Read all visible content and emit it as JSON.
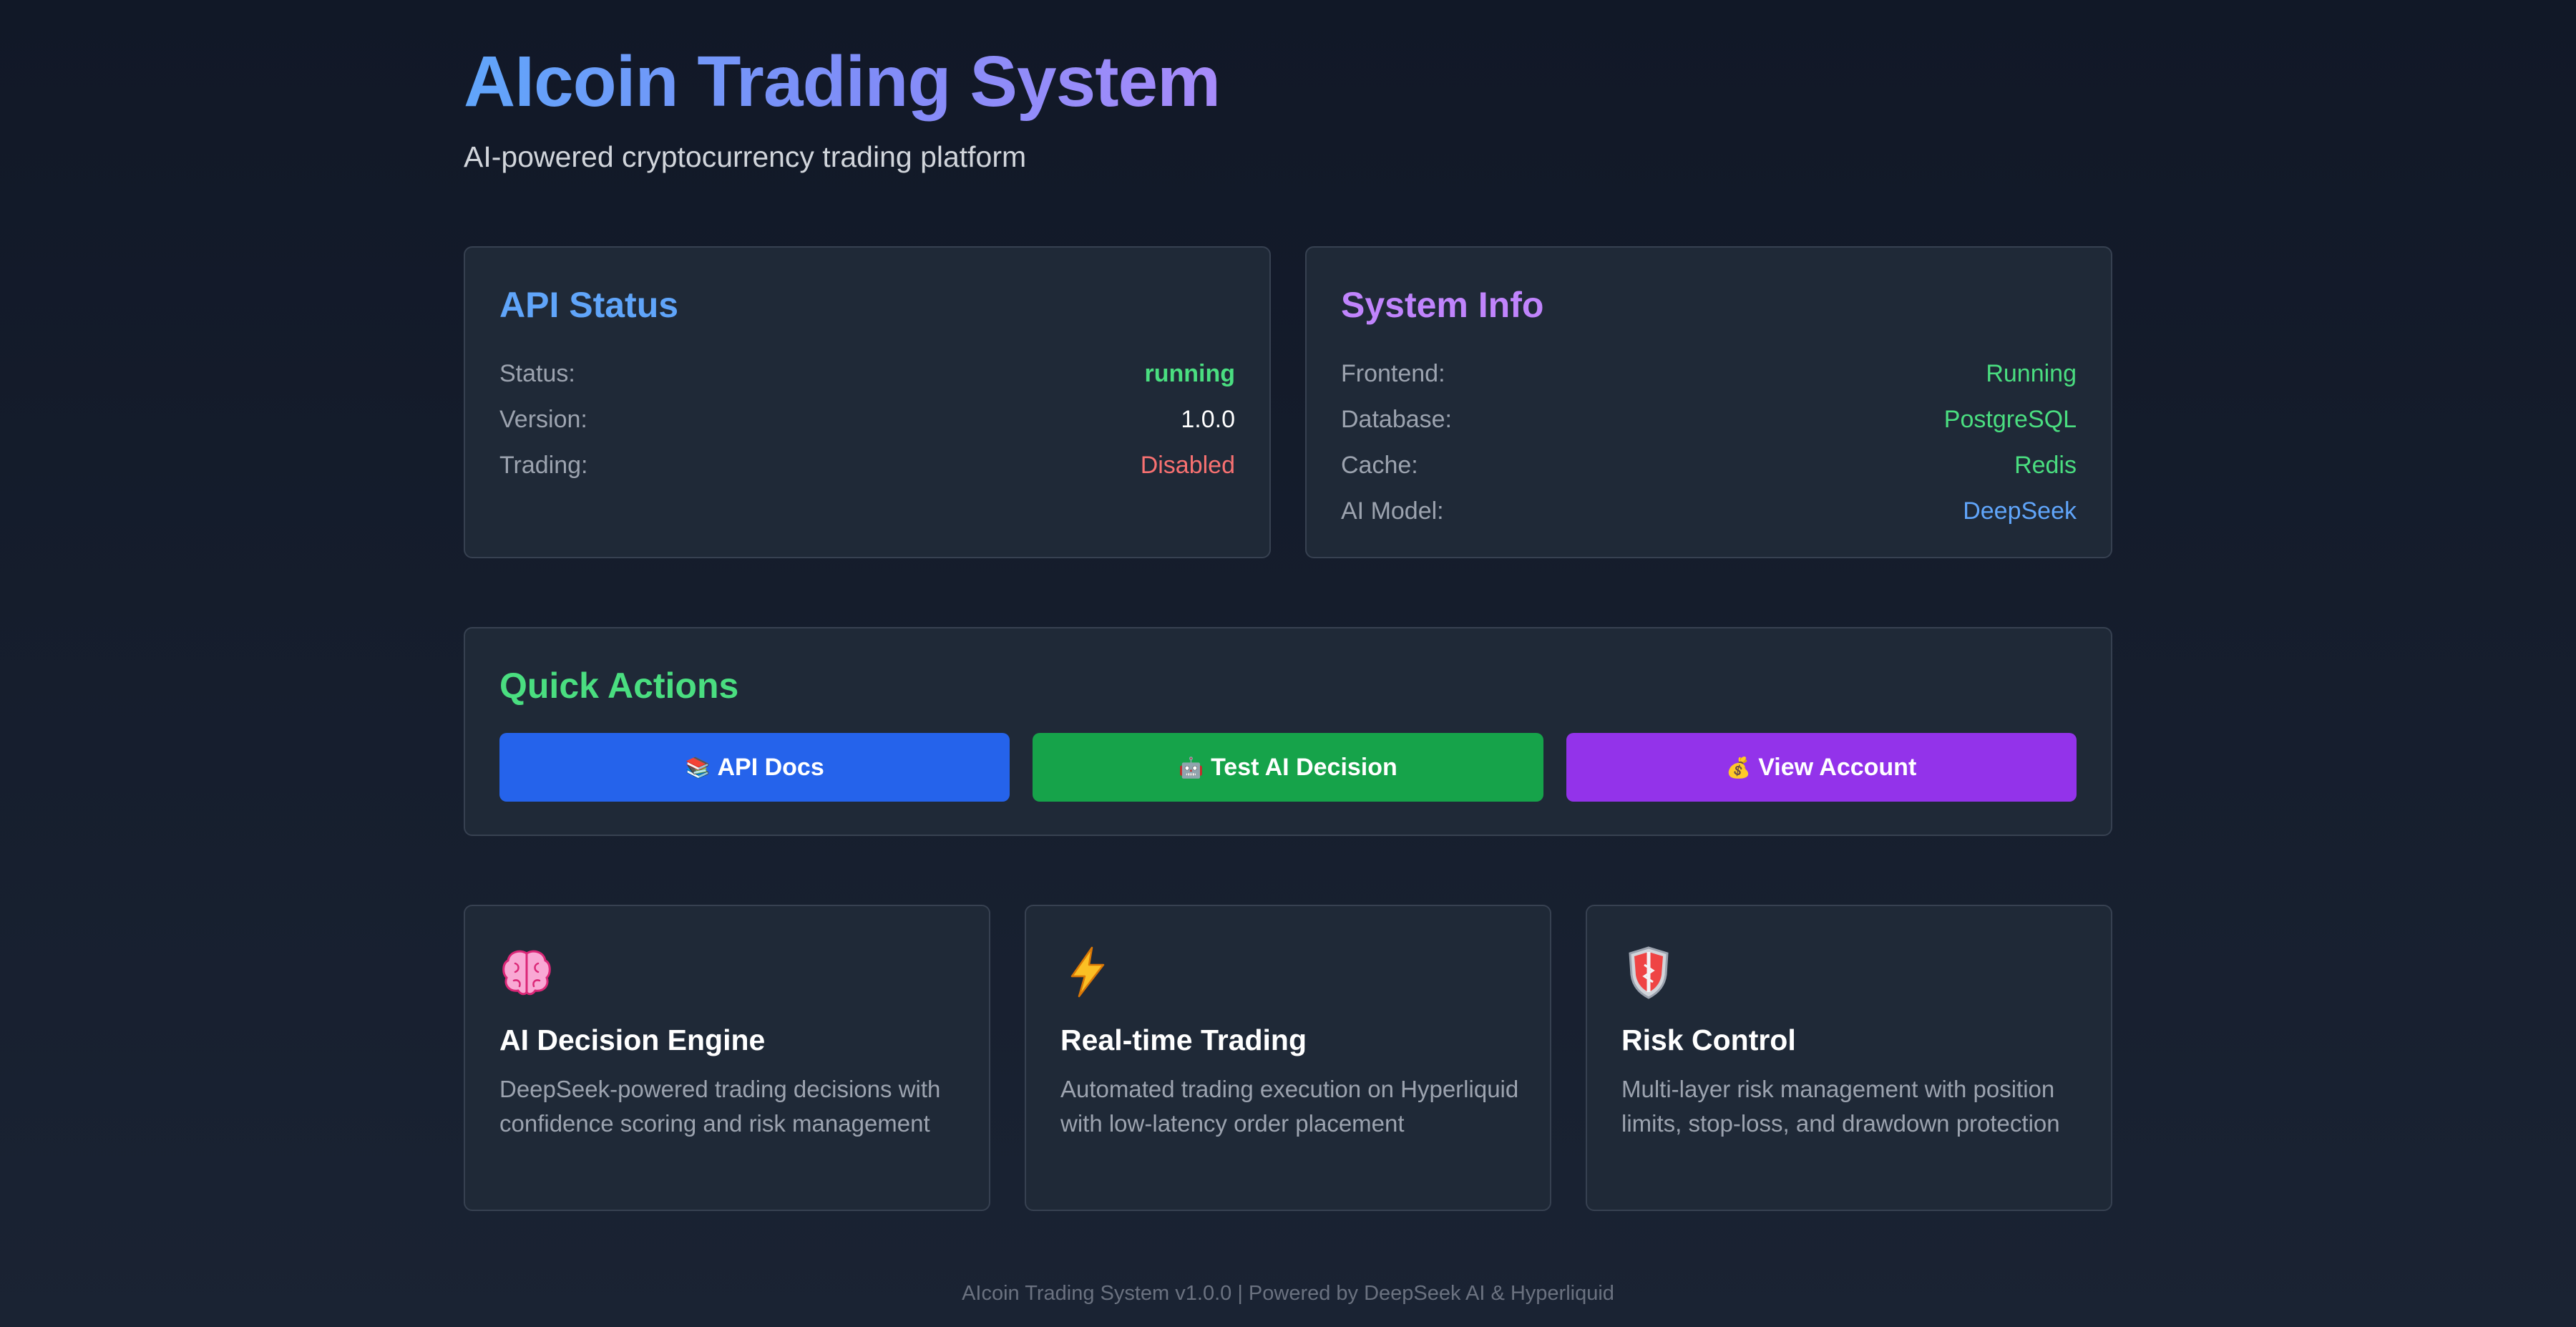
{
  "header": {
    "title": "AIcoin Trading System",
    "subtitle": "AI-powered cryptocurrency trading platform"
  },
  "api_status": {
    "title": "API Status",
    "rows": [
      {
        "label": "Status:",
        "value": "running"
      },
      {
        "label": "Version:",
        "value": "1.0.0"
      },
      {
        "label": "Trading:",
        "value": "Disabled"
      }
    ]
  },
  "system_info": {
    "title": "System Info",
    "rows": [
      {
        "label": "Frontend:",
        "value": "Running"
      },
      {
        "label": "Database:",
        "value": "PostgreSQL"
      },
      {
        "label": "Cache:",
        "value": "Redis"
      },
      {
        "label": "AI Model:",
        "value": "DeepSeek"
      }
    ]
  },
  "quick_actions": {
    "title": "Quick Actions",
    "buttons": [
      {
        "emoji": "📚",
        "label": "API Docs",
        "icon": "books-icon",
        "color": "#2563eb"
      },
      {
        "emoji": "🤖",
        "label": "Test AI Decision",
        "icon": "robot-icon",
        "color": "#16a34a"
      },
      {
        "emoji": "💰",
        "label": "View Account",
        "icon": "money-bag-icon",
        "color": "#9333ea"
      }
    ]
  },
  "features": [
    {
      "icon": "brain-icon",
      "title": "AI Decision Engine",
      "description": "DeepSeek-powered trading decisions with confidence scoring and risk management"
    },
    {
      "icon": "lightning-icon",
      "title": "Real-time Trading",
      "description": "Automated trading execution on Hyperliquid with low-latency order placement"
    },
    {
      "icon": "shield-icon",
      "title": "Risk Control",
      "description": "Multi-layer risk management with position limits, stop-loss, and drawdown protection"
    }
  ],
  "footer": {
    "text": "AIcoin Trading System v1.0.0 | Powered by DeepSeek AI & Hyperliquid"
  },
  "colors": {
    "background": "#111827",
    "card": "#1f2937",
    "accent_blue": "#60a5fa",
    "accent_purple": "#c084fc",
    "accent_green": "#4ade80",
    "status_red": "#f87171"
  }
}
